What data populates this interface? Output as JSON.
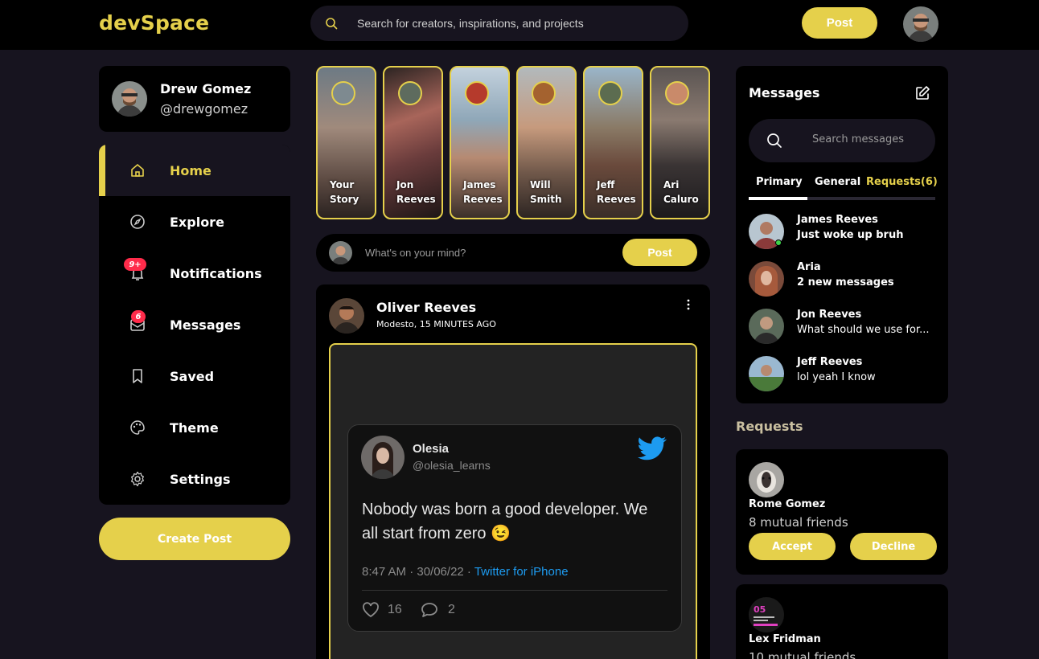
{
  "nav": {
    "logo": "devSpace",
    "search_placeholder": "Search for creators, inspirations, and projects",
    "post_label": "Post"
  },
  "profile": {
    "name": "Drew Gomez",
    "handle": "@drewgomez"
  },
  "sidebar": {
    "items": [
      {
        "label": "Home",
        "icon": "home-icon",
        "active": true
      },
      {
        "label": "Explore",
        "icon": "compass-icon"
      },
      {
        "label": "Notifications",
        "icon": "bell-icon",
        "badge": "9+"
      },
      {
        "label": "Messages",
        "icon": "envelope-icon",
        "badge": "6"
      },
      {
        "label": "Saved",
        "icon": "bookmark-icon"
      },
      {
        "label": "Theme",
        "icon": "palette-icon"
      },
      {
        "label": "Settings",
        "icon": "gear-icon"
      }
    ],
    "create_post_label": "Create Post"
  },
  "stories": [
    {
      "name": "Your Story"
    },
    {
      "name": "Jon Reeves"
    },
    {
      "name": "James Reeves"
    },
    {
      "name": "Will Smith"
    },
    {
      "name": "Jeff Reeves"
    },
    {
      "name": "Ari Caluro"
    }
  ],
  "composer": {
    "placeholder": "What's on your mind?",
    "post_label": "Post"
  },
  "feed": {
    "author": "Oliver Reeves",
    "meta": "Modesto, 15 MINUTES AGO",
    "tweet": {
      "name": "Olesia",
      "handle": "@olesia_learns",
      "text": "Nobody was born a good developer. We all start from zero 😉",
      "time": "8:47 AM · 30/06/22 · ",
      "source": "Twitter for iPhone",
      "likes": "16",
      "replies": "2"
    }
  },
  "messages": {
    "title": "Messages",
    "search_placeholder": "Search messages",
    "tabs": [
      "Primary",
      "General",
      "Requests(6)"
    ],
    "items": [
      {
        "name": "James Reeves",
        "text": "Just woke up bruh",
        "online": true,
        "bold": true
      },
      {
        "name": "Aria",
        "text": "2 new messages",
        "bold": true
      },
      {
        "name": "Jon Reeves",
        "text": "What should we use for..."
      },
      {
        "name": "Jeff Reeves",
        "text": "lol yeah I know"
      }
    ]
  },
  "requests": {
    "title": "Requests",
    "items": [
      {
        "name": "Rome Gomez",
        "mutual": "8 mutual friends",
        "accept": "Accept",
        "decline": "Decline"
      },
      {
        "name": "Lex Fridman",
        "mutual": "10 mutual friends"
      }
    ]
  },
  "colors": {
    "accent": "#e5d04b",
    "bg": "#17141f",
    "card": "#000000",
    "badge": "#ff2b4a",
    "online": "#3dd44a"
  }
}
